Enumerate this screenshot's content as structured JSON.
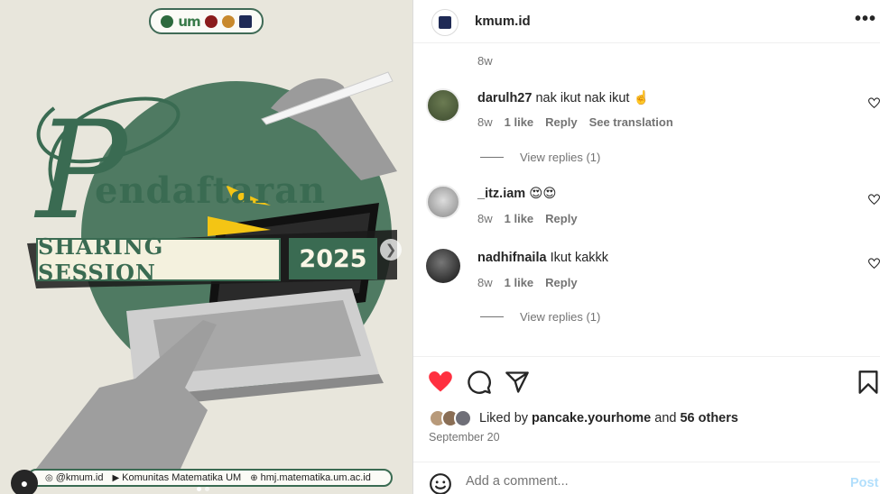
{
  "post_image": {
    "logo_text": "um",
    "title": "Pendaftaran",
    "title_initial": "P",
    "title_rest": "endaftaran",
    "session_label": "SHARING SESSION",
    "year": "2025",
    "footer": {
      "instagram": "@kmum.id",
      "youtube": "Komunitas Matematika UM",
      "website": "hmj.matematika.um.ac.id"
    },
    "next_icon": "chevron-right-icon",
    "colors": {
      "green": "#3a6b52",
      "cream": "#f4f1de",
      "background": "#e8e6dc"
    }
  },
  "header": {
    "username": "kmum.id",
    "more_icon": "more-horizontal-icon"
  },
  "top_time": "8w",
  "comments": [
    {
      "username": "darulh27",
      "text": "nak ikut nak ikut ☝️",
      "time": "8w",
      "likes": "1 like",
      "reply": "Reply",
      "translate": "See translation"
    },
    {
      "username": "_itz.iam",
      "text": "😍😍",
      "time": "8w",
      "likes": "1 like",
      "reply": "Reply"
    },
    {
      "username": "nadhifnaila",
      "text": "Ikut kakkk",
      "time": "8w",
      "likes": "1 like",
      "reply": "Reply"
    }
  ],
  "view_replies": "View replies (1)",
  "actions": {
    "like_icon": "heart-filled-icon",
    "comment_icon": "comment-icon",
    "share_icon": "send-icon",
    "save_icon": "bookmark-icon",
    "like_color": "#ff3040"
  },
  "likes": {
    "prefix": "Liked by",
    "user": "pancake.yourhome",
    "and": "and",
    "others": "56 others"
  },
  "date": "September 20",
  "add_comment": {
    "placeholder": "Add a comment...",
    "post_label": "Post",
    "emoji_icon": "emoji-icon"
  }
}
